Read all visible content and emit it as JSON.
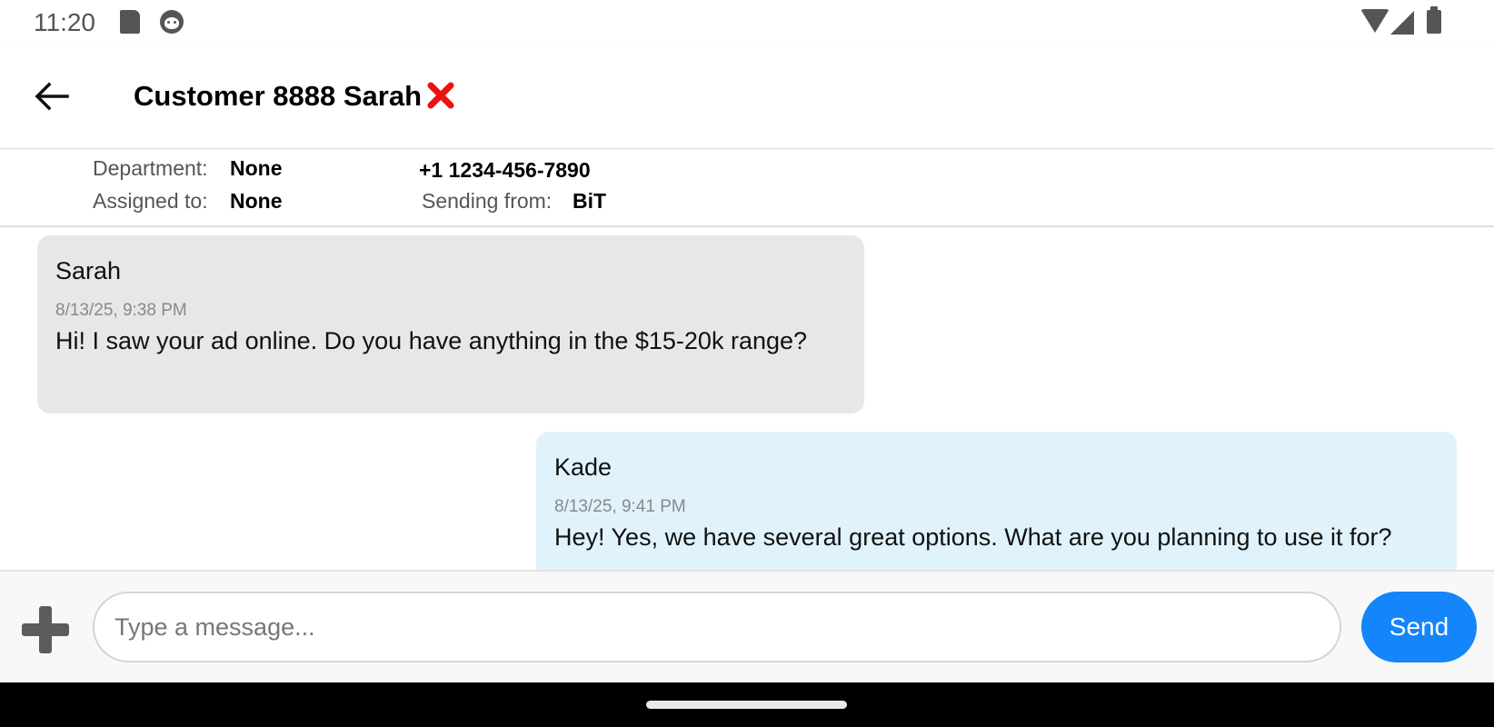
{
  "status_bar": {
    "time": "11:20",
    "icons": [
      "sd-card-icon",
      "android-face-icon",
      "wifi-icon",
      "signal-icon",
      "battery-icon"
    ]
  },
  "header": {
    "back_icon": "arrow-left-icon",
    "title": "Customer 8888  Sarah",
    "status_icon": "red-x-icon",
    "status_color": "#ee1111"
  },
  "info": {
    "department_label": "Department:",
    "department_value": "None",
    "assigned_label": "Assigned to:",
    "assigned_value": "None",
    "phone": "+1 1234-456-7890",
    "sending_label": "Sending from:",
    "sending_value": "BiT"
  },
  "messages": [
    {
      "direction": "incoming",
      "sender": "Sarah",
      "timestamp": "8/13/25, 9:38 PM",
      "text": "Hi! I saw your ad online. Do you have anything in the $15-20k range?",
      "bubble_color": "#e7e7e7"
    },
    {
      "direction": "outgoing",
      "sender": "Kade",
      "timestamp": "8/13/25, 9:41 PM",
      "text": "Hey! Yes, we have several great options. What are you planning to use it for?",
      "bubble_color": "#e0f3fd"
    }
  ],
  "composer": {
    "attach_icon": "plus-icon",
    "input_value": "",
    "placeholder": "Type a message...",
    "send_label": "Send",
    "send_color": "#1485fb"
  }
}
